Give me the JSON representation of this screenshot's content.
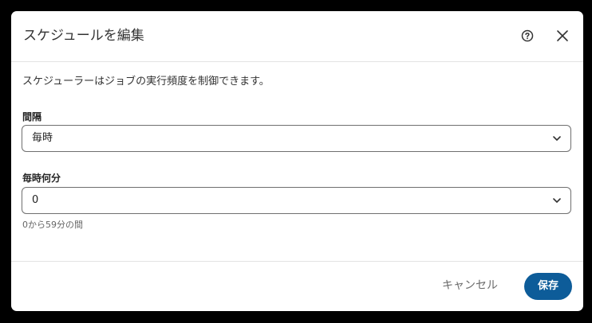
{
  "dialog": {
    "title": "スケジュールを編集",
    "help_icon": "help-circle-icon",
    "close_icon": "close-icon"
  },
  "description": "スケジューラーはジョブの実行頻度を制御できます。",
  "interval": {
    "label": "間隔",
    "value": "毎時"
  },
  "minute": {
    "label": "毎時何分",
    "value": "0",
    "hint": "0から59分の間"
  },
  "footer": {
    "cancel_label": "キャンセル",
    "save_label": "保存"
  },
  "colors": {
    "primary": "#0d5c99",
    "border": "#6f6f6f",
    "backdrop": "#000000"
  }
}
